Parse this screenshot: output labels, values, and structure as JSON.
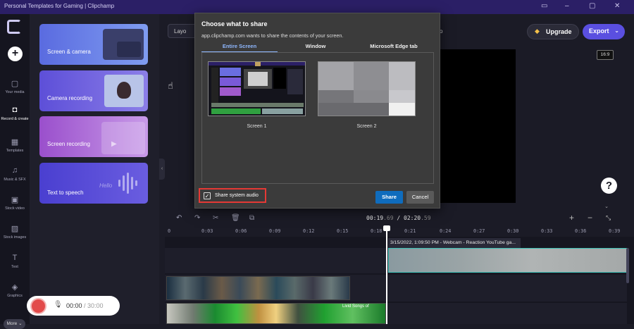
{
  "window": {
    "title": "Personal Templates for Gaming | Clipchamp",
    "controls": [
      "▭",
      "–",
      "▢",
      "✕"
    ]
  },
  "nav": {
    "items": [
      {
        "icon": "folder-icon",
        "glyph": "▢",
        "label": "Your media"
      },
      {
        "icon": "record-icon",
        "glyph": "◘",
        "label": "Record & create"
      },
      {
        "icon": "templates-icon",
        "glyph": "▦",
        "label": "Templates"
      },
      {
        "icon": "music-icon",
        "glyph": "♫",
        "label": "Music & SFX"
      },
      {
        "icon": "stock-video-icon",
        "glyph": "▣",
        "label": "Stock video"
      },
      {
        "icon": "stock-images-icon",
        "glyph": "▨",
        "label": "Stock images"
      },
      {
        "icon": "text-icon",
        "glyph": "T",
        "label": "Text"
      },
      {
        "icon": "graphics-icon",
        "glyph": "◈",
        "label": "Graphics"
      }
    ],
    "more_label": "More ⌄",
    "add_glyph": "+"
  },
  "panel": {
    "cards": [
      {
        "label": "Screen & camera"
      },
      {
        "label": "Camera recording"
      },
      {
        "label": "Screen recording"
      },
      {
        "label": "Text to speech"
      }
    ],
    "tts_hello": "Hello"
  },
  "recorder": {
    "time_current": "00:00",
    "time_total": " / 30:00"
  },
  "toolbar": {
    "layout_label": "Layo",
    "upgrade_label": "Upgrade",
    "export_label": "Export",
    "ratio_label": "16:9",
    "help_glyph": "?"
  },
  "timeline": {
    "time_current": "00:19",
    "time_current_frac": ".69",
    "time_total": "02:20",
    "time_total_frac": ".59",
    "ticks": [
      "0",
      "0:03",
      "0:06",
      "0:09",
      "0:12",
      "0:15",
      "0:18",
      "0:21",
      "0:24",
      "0:27",
      "0:30",
      "0:33",
      "0:36",
      "0:39"
    ],
    "webcam_clip_label": "3/15/2022, 1:09:50 PM - Webcam - Reaction YouTube ga...",
    "clip2_label": "Livid Songs of"
  },
  "dialog": {
    "title": "Choose what to share",
    "subtitle": "app.clipchamp.com wants to share the contents of your screen.",
    "tabs": [
      {
        "label": "Entire Screen",
        "active": true
      },
      {
        "label": "Window",
        "active": false
      },
      {
        "label": "Microsoft Edge tab",
        "active": false
      }
    ],
    "screens": [
      {
        "label": "Screen 1"
      },
      {
        "label": "Screen 2"
      }
    ],
    "share_audio_label": "Share system audio",
    "share_audio_checked": true,
    "share_button": "Share",
    "cancel_button": "Cancel",
    "edge_label": "o"
  },
  "colors": {
    "accent": "#5a4fe0",
    "share_blue": "#0f6cbd",
    "highlight_red": "#e53935",
    "titlebar": "#2b1f66"
  }
}
